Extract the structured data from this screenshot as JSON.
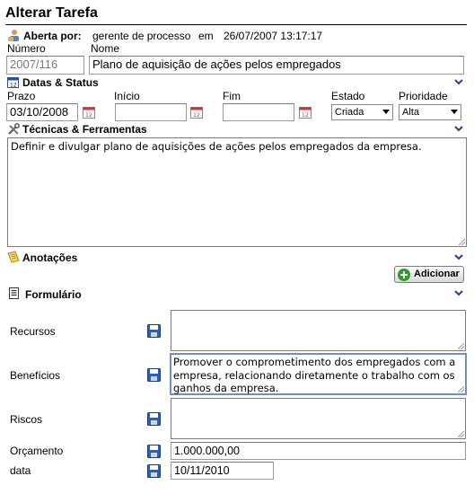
{
  "page": {
    "title": "Alterar Tarefa"
  },
  "header": {
    "opened_by_label": "Aberta por:",
    "opened_by_value": "gerente de processo",
    "em": "em",
    "opened_at": "26/07/2007 13:17:17"
  },
  "fields": {
    "numero_label": "Número",
    "numero_value": "2007/116",
    "nome_label": "Nome",
    "nome_value": "Plano de aquisição de ações pelos empregados"
  },
  "datas": {
    "section_title": "Datas & Status",
    "prazo_label": "Prazo",
    "prazo_value": "03/10/2008",
    "inicio_label": "Início",
    "inicio_value": "",
    "fim_label": "Fim",
    "fim_value": "",
    "estado_label": "Estado",
    "estado_value": "Criada",
    "prioridade_label": "Prioridade",
    "prioridade_value": "Alta"
  },
  "tecnicas": {
    "section_title": "Técnicas & Ferramentas",
    "text": "Definir e divulgar plano de aquisições de ações pelos empregados da empresa."
  },
  "anotacoes": {
    "section_title": "Anotações",
    "add_button": "Adicionar"
  },
  "formulario": {
    "section_title": "Formulário",
    "recursos_label": "Recursos",
    "recursos_value": "",
    "beneficios_label": "Benefícios",
    "beneficios_value": "Promover o comprometimento dos empregados com a empresa, relacionando diretamente o trabalho com os ganhos da empresa.",
    "riscos_label": "Riscos",
    "riscos_value": "",
    "orcamento_label": "Orçamento",
    "orcamento_value": "1.000.000,00",
    "data_label": "data",
    "data_value": "10/11/2010"
  },
  "colors": {
    "accent": "#1f3f9e",
    "focus_border": "#6b8fc7",
    "add_icon": "#2e9b2e"
  }
}
